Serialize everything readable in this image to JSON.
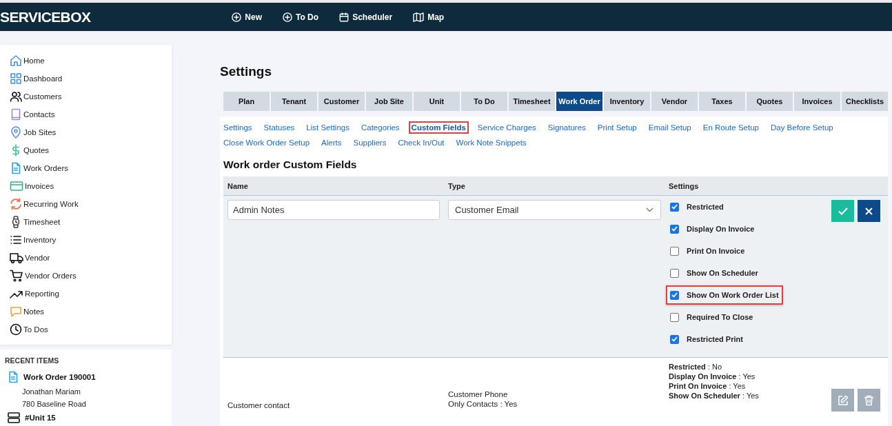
{
  "header": {
    "logo": "SERVICEBOX",
    "actions": [
      {
        "label": "New"
      },
      {
        "label": "To Do"
      },
      {
        "label": "Scheduler"
      },
      {
        "label": "Map"
      }
    ]
  },
  "sidebar": {
    "items": [
      {
        "label": "Home"
      },
      {
        "label": "Dashboard"
      },
      {
        "label": "Customers"
      },
      {
        "label": "Contacts"
      },
      {
        "label": "Job Sites"
      },
      {
        "label": "Quotes"
      },
      {
        "label": "Work Orders"
      },
      {
        "label": "Invoices"
      },
      {
        "label": "Recurring Work"
      },
      {
        "label": "Timesheet"
      },
      {
        "label": "Inventory"
      },
      {
        "label": "Vendor"
      },
      {
        "label": "Vendor Orders"
      },
      {
        "label": "Reporting"
      },
      {
        "label": "Notes"
      },
      {
        "label": "To Dos"
      }
    ]
  },
  "recent_items": {
    "title": "RECENT ITEMS",
    "items": [
      {
        "kind": "work-order",
        "title": "Work Order 190001",
        "lines": [
          "Jonathan Mariam",
          "780 Baseline Road"
        ]
      },
      {
        "kind": "unit",
        "title": "#Unit 15"
      }
    ]
  },
  "page": {
    "title": "Settings",
    "tabs": [
      {
        "label": "Plan",
        "selected": false
      },
      {
        "label": "Tenant",
        "selected": false
      },
      {
        "label": "Customer",
        "selected": false
      },
      {
        "label": "Job Site",
        "selected": false
      },
      {
        "label": "Unit",
        "selected": false
      },
      {
        "label": "To Do",
        "selected": false
      },
      {
        "label": "Timesheet",
        "selected": false
      },
      {
        "label": "Work Order",
        "selected": true
      },
      {
        "label": "Inventory",
        "selected": false
      },
      {
        "label": "Vendor",
        "selected": false
      },
      {
        "label": "Taxes",
        "selected": false
      },
      {
        "label": "Quotes",
        "selected": false
      },
      {
        "label": "Invoices",
        "selected": false
      },
      {
        "label": "Checklists",
        "selected": false
      }
    ],
    "sub_links": [
      {
        "label": "Settings",
        "selected": false
      },
      {
        "label": "Statuses",
        "selected": false
      },
      {
        "label": "List Settings",
        "selected": false
      },
      {
        "label": "Categories",
        "selected": false
      },
      {
        "label": "Custom Fields",
        "selected": true
      },
      {
        "label": "Service Charges",
        "selected": false
      },
      {
        "label": "Signatures",
        "selected": false
      },
      {
        "label": "Print Setup",
        "selected": false
      },
      {
        "label": "Email Setup",
        "selected": false
      },
      {
        "label": "En Route Setup",
        "selected": false
      },
      {
        "label": "Day Before Setup",
        "selected": false
      },
      {
        "label": "Close Work Order Setup",
        "selected": false
      },
      {
        "label": "Alerts",
        "selected": false
      },
      {
        "label": "Suppliers",
        "selected": false
      },
      {
        "label": "Check In/Out",
        "selected": false
      },
      {
        "label": "Work Note Snippets",
        "selected": false
      }
    ],
    "section_title": "Work order Custom Fields",
    "table": {
      "columns": [
        "Name",
        "Type",
        "Settings"
      ],
      "edit_row": {
        "name": "Admin Notes",
        "type": "Customer Email",
        "settings": [
          {
            "label": "Restricted",
            "checked": true,
            "highlighted": false
          },
          {
            "label": "Display On Invoice",
            "checked": true,
            "highlighted": false
          },
          {
            "label": "Print On Invoice",
            "checked": false,
            "highlighted": false
          },
          {
            "label": "Show On Scheduler",
            "checked": false,
            "highlighted": false
          },
          {
            "label": "Show On Work Order List",
            "checked": true,
            "highlighted": true
          },
          {
            "label": "Required To Close",
            "checked": false,
            "highlighted": false
          },
          {
            "label": "Restricted Print",
            "checked": true,
            "highlighted": false
          }
        ]
      },
      "rows": [
        {
          "name": "Customer contact",
          "type_lines": [
            "Customer Phone",
            "Only Contacts : Yes"
          ],
          "settings_lines": [
            "**Restricted** : No",
            "**Display On Invoice** : Yes",
            "**Print On Invoice** : Yes",
            "**Show On Scheduler** : Yes"
          ]
        }
      ]
    }
  }
}
